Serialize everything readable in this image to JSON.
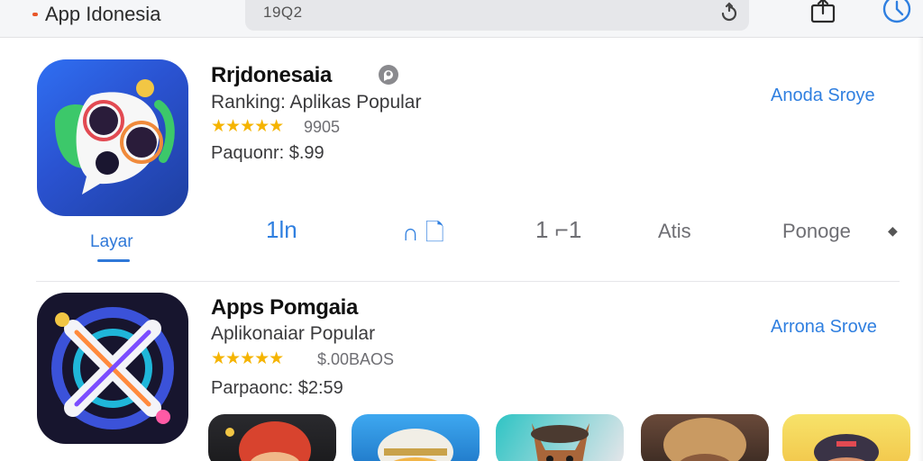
{
  "header": {
    "brand": "App Idonesia",
    "search_value": "19Q2"
  },
  "featured": {
    "title": "Rrjdonesaia",
    "subtitle": "Ranking: Aplikas Popular",
    "stars": "★★★★★",
    "rating_count": "9905",
    "price": "Paquonr: $.99",
    "get_label": "Anoda Sroye",
    "tab_label": "Layar",
    "segments": [
      "1ln",
      "∩ 🗋",
      "1 ⌐1",
      "Atis",
      "Ponoge"
    ],
    "chevron": "◆"
  },
  "second": {
    "title": "Apps Pomgaia",
    "subtitle": "Aplikonaiar Popular",
    "stars": "★★★★★",
    "rating_count": "$.00BAOS",
    "price": "Parpaonc: $2:59",
    "get_label": "Arrona Srove"
  },
  "colors": {
    "accent": "#2f7fe0",
    "star": "#f5b400",
    "brand_dot": "#e8572a"
  }
}
